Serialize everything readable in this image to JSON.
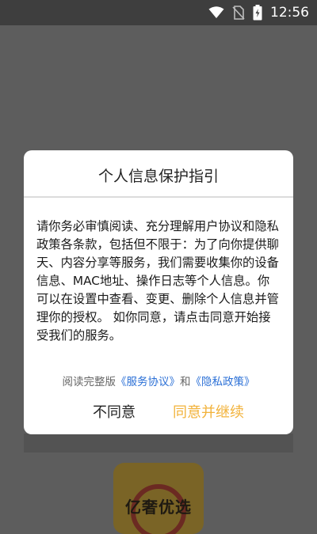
{
  "status_bar": {
    "time": "12:56",
    "icons": [
      "wifi-icon",
      "no-sim-icon",
      "battery-charging-icon"
    ]
  },
  "app": {
    "logo_text": "亿奢优选"
  },
  "dialog": {
    "title": "个人信息保护指引",
    "body": "请你务必审慎阅读、充分理解用户协议和隐私政策各条款，包括但不限于：为了向你提供聊天、内容分享等服务，我们需要收集你的设备信息、MAC地址、操作日志等个人信息。你可以在设置中查看、变更、删除个人信息并管理你的授权。 如你同意，请点击同意开始接受我们的服务。",
    "links": {
      "prefix": "阅读完整版",
      "service_agreement": "《服务协议》",
      "conjunction": "和",
      "privacy_policy": "《隐私政策》"
    },
    "disagree_label": "不同意",
    "agree_label": "同意并继续"
  },
  "colors": {
    "agree": "#f2b23a",
    "link": "#2a6fd6"
  }
}
